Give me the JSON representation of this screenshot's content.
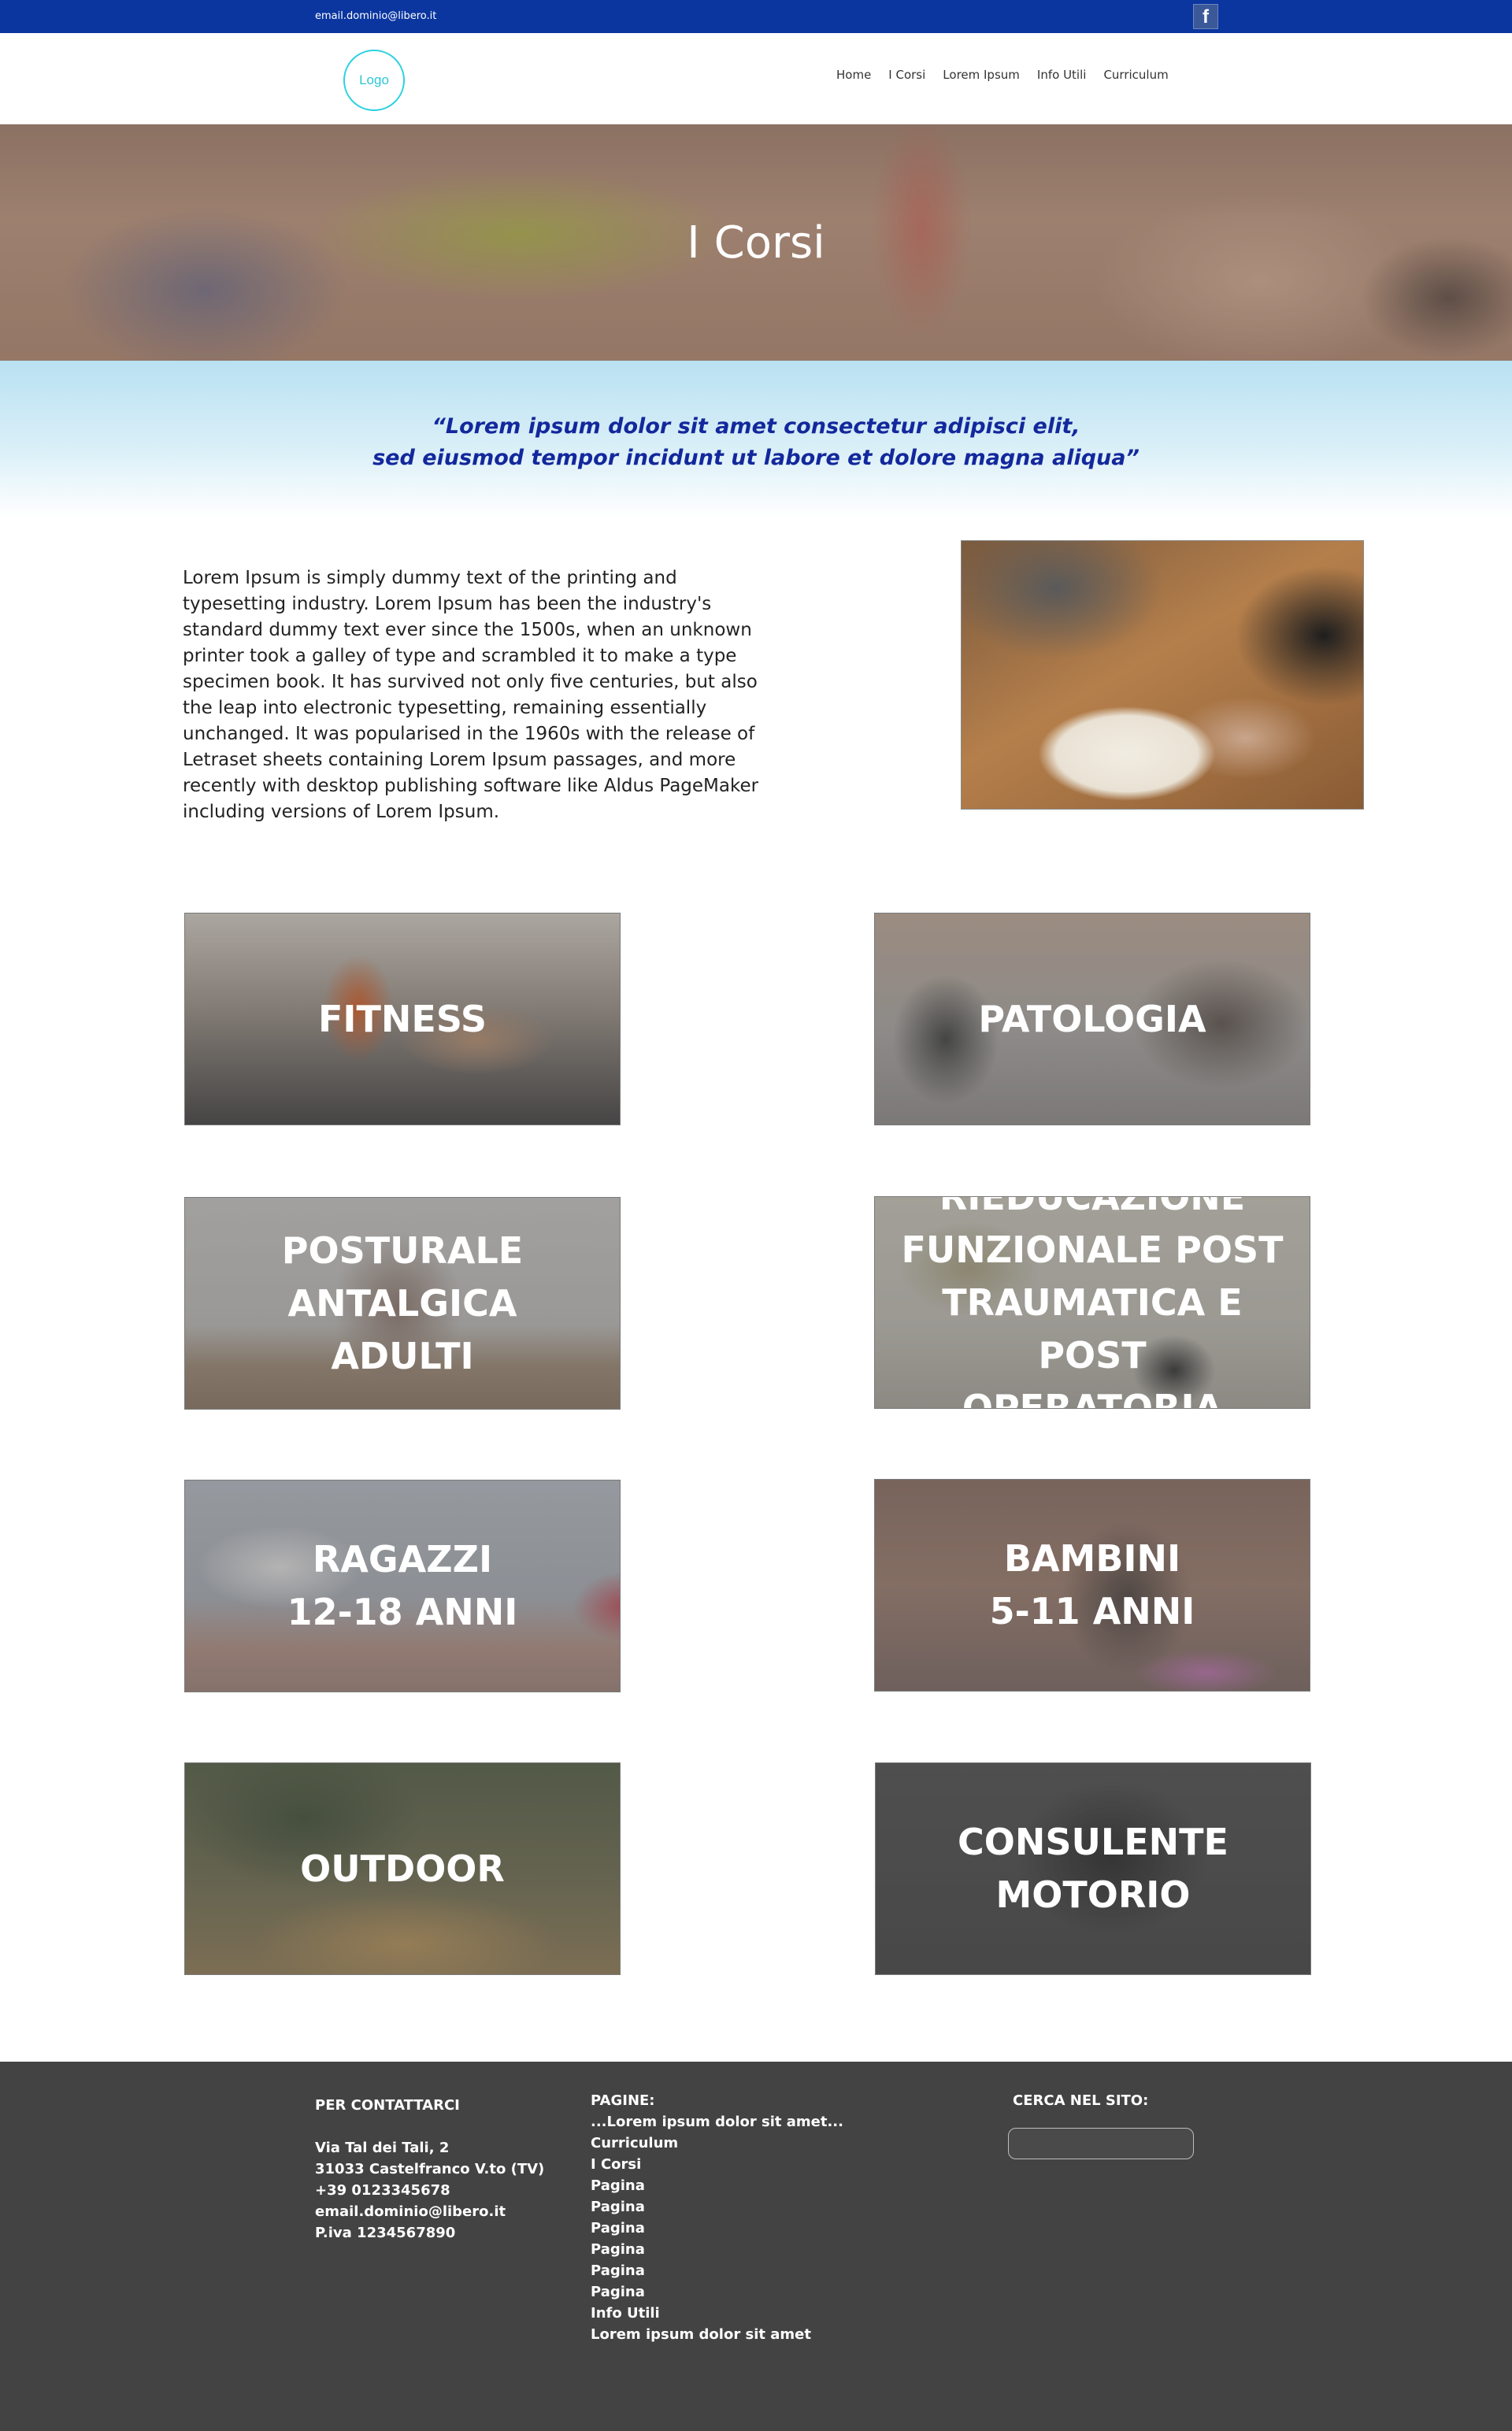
{
  "topbar": {
    "email": "email.dominio@libero.it",
    "facebook_icon": "facebook-icon"
  },
  "header": {
    "logo_text": "Logo",
    "nav": [
      "Home",
      "I Corsi",
      "Lorem Ipsum",
      "Info Utili",
      "Curriculum"
    ]
  },
  "hero": {
    "title": "I Corsi"
  },
  "quote": {
    "line1": "“Lorem ipsum dolor sit amet consectetur adipisci elit,",
    "line2": "sed eiusmod tempor incidunt ut labore et dolore magna aliqua”"
  },
  "intro": {
    "text": "Lorem Ipsum is simply dummy text of the printing and typesetting industry. Lorem Ipsum has been the industry's standard dummy text ever since the 1500s, when an unknown printer took a galley of type and scrambled it to make a type specimen book. It has survived not only five centuries, but also the leap into electronic typesetting, remaining essentially unchanged. It was popularised in the 1960s with the release of Letraset sheets containing Lorem Ipsum passages, and more recently with desktop publishing software like Aldus PageMaker including versions of Lorem Ipsum."
  },
  "courses": [
    "FITNESS",
    "PATOLOGIA",
    "POSTURALE\nANTALGICA\nADULTI",
    "RIEDUCAZIONE\nFUNZIONALE POST\nTRAUMATICA E POST\nOPERATORIA",
    "RAGAZZI\n12-18 ANNI",
    "BAMBINI\n5-11 ANNI",
    "OUTDOOR",
    "CONSULENTE\nMOTORIO"
  ],
  "footer": {
    "contact": {
      "title": "PER CONTATTARCI",
      "lines": [
        "Via Tal dei Tali, 2",
        "31033 Castelfranco V.to (TV)",
        "+39 0123345678",
        "email.dominio@libero.it",
        "P.iva 1234567890"
      ]
    },
    "pages": {
      "title": "PAGINE:",
      "items": [
        "...Lorem ipsum dolor sit amet...",
        "Curriculum",
        "I Corsi",
        "Pagina",
        "Pagina",
        "Pagina",
        "Pagina",
        "Pagina",
        "Pagina",
        "Info Utili",
        "Lorem ipsum dolor sit amet"
      ]
    },
    "search": {
      "title": "CERCA NEL SITO:",
      "placeholder": ""
    }
  }
}
